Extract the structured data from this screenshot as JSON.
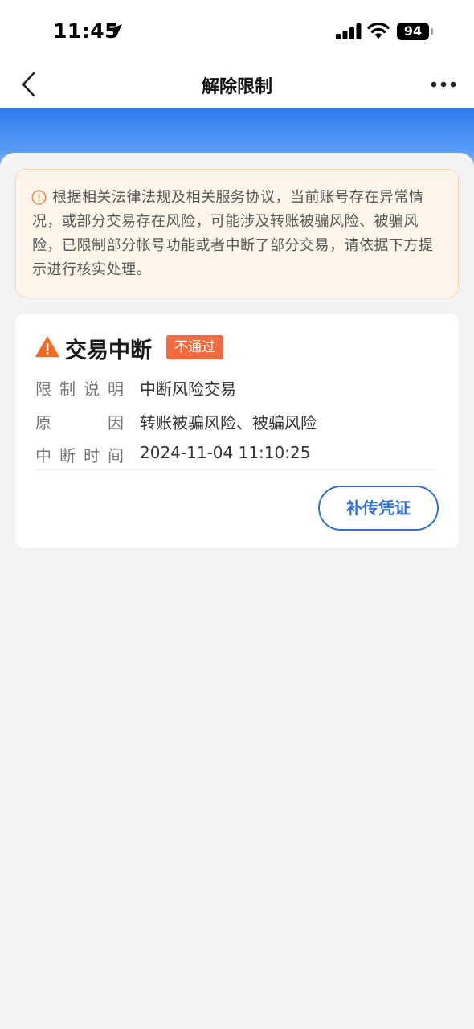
{
  "status_bar": {
    "time": "11:45",
    "battery": "94"
  },
  "nav": {
    "title": "解除限制"
  },
  "notice": {
    "text": "根据相关法律法规及相关服务协议，当前账号存在异常情况，或部分交易存在风险，可能涉及转账被骗风险、被骗风险，已限制部分帐号功能或者中断了部分交易，请依据下方提示进行核实处理。"
  },
  "card": {
    "title": "交易中断",
    "badge": "不通过",
    "rows": [
      {
        "label": "限制说明",
        "value": "中断风险交易"
      },
      {
        "label": "原因",
        "value": "转账被骗风险、被骗风险"
      },
      {
        "label": "中断时间",
        "value": "2024-11-04 11:10:25"
      }
    ],
    "button_label": "补传凭证"
  },
  "colors": {
    "primary_blue": "#2f6fe0",
    "warning_orange": "#f26a3d",
    "notice_bg": "#fdf4ea"
  }
}
